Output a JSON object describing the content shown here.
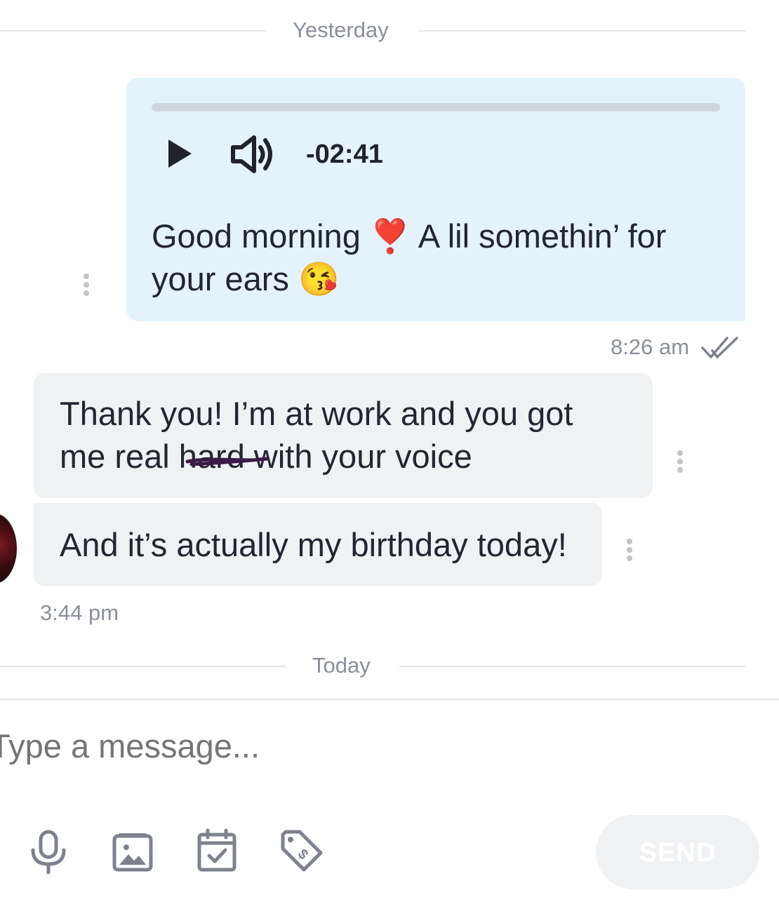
{
  "separators": {
    "yesterday": "Yesterday",
    "today": "Today"
  },
  "outgoing": {
    "audio": {
      "duration": "-02:41",
      "progress": 0
    },
    "text_part1": "Good morning",
    "emoji1": "❣️",
    "text_part2": "A lil somethin’ for your ears",
    "emoji2": "😘",
    "time": "8:26 am",
    "status_icon": "double-check-icon"
  },
  "incoming": {
    "message1_before": "Thank you! I’m at work and you got me real ",
    "message1_struck": "hard",
    "message1_after": " with your voice",
    "message2": "And it’s actually my birthday today!",
    "time": "3:44 pm"
  },
  "composer": {
    "placeholder": "Type a message...",
    "send_label": "SEND",
    "tools": [
      "microphone-icon",
      "image-icon",
      "calendar-check-icon",
      "price-tag-icon"
    ]
  },
  "colors": {
    "outgoing_bubble": "#e3f2fb",
    "incoming_bubble": "#f0f1f3",
    "muted_text": "#8a8f99",
    "send_button": "#f0f1f3"
  }
}
